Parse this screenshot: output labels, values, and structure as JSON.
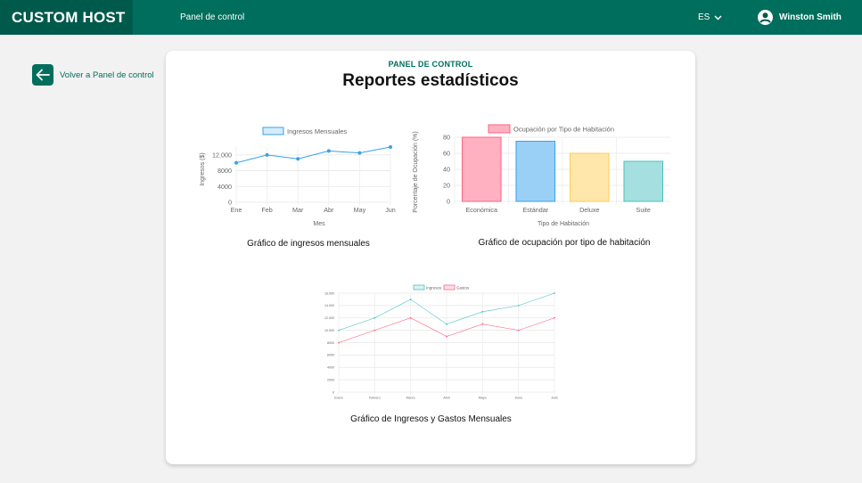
{
  "header": {
    "brand": "CUSTOM HOST",
    "nav_label": "Panel de control",
    "language": "ES",
    "user_name": "Winston Smith",
    "colors": {
      "bar": "#006e5c",
      "brand_bg": "#005a4b"
    }
  },
  "back": {
    "label": "Volver a Panel de control",
    "icon": "arrow-left-icon"
  },
  "card": {
    "kicker": "PANEL DE CONTROL",
    "title": "Reportes estadísticos"
  },
  "captions": {
    "income": "Gráfico de ingresos mensuales",
    "occupancy": "Gráfico de ocupación por tipo de habitación",
    "income_expenses": "Gráfico de Ingresos y Gastos Mensuales"
  },
  "chart_data": [
    {
      "type": "line",
      "title": "",
      "x": [
        "Ene",
        "Feb",
        "Mar",
        "Abr",
        "May",
        "Jun"
      ],
      "series": [
        {
          "name": "Ingresos Mensuales",
          "values": [
            10000,
            12000,
            11000,
            13000,
            12500,
            14000
          ],
          "color": "#36a2eb"
        }
      ],
      "xlabel": "Mes",
      "ylabel": "Ingresos ($)",
      "ylim": [
        0,
        14000
      ],
      "yticks": [
        "0",
        "4000",
        "8000",
        "12.000"
      ],
      "legend": "top",
      "grid": true
    },
    {
      "type": "bar",
      "title": "",
      "categories": [
        "Económica",
        "Estándar",
        "Deluxe",
        "Suite"
      ],
      "series": [
        {
          "name": "Ocupación por Tipo de Habitación",
          "values": [
            80,
            75,
            60,
            50
          ]
        }
      ],
      "colors": [
        "#ffb1c1",
        "#9ad0f5",
        "#ffe6aa",
        "#a5dfdf"
      ],
      "borders": [
        "#ff6384",
        "#36a2eb",
        "#ffcd56",
        "#4bc0c0"
      ],
      "xlabel": "Tipo de Habitación",
      "ylabel": "Porcentaje de Ocupación (%)",
      "ylim": [
        0,
        80
      ],
      "yticks": [
        "0",
        "20",
        "40",
        "60",
        "80"
      ],
      "legend": "top",
      "grid": true
    },
    {
      "type": "line",
      "title": "",
      "x": [
        "Enero",
        "Febrero",
        "Marzo",
        "Abril",
        "Mayo",
        "Junio",
        "Julio"
      ],
      "series": [
        {
          "name": "Ingresos",
          "values": [
            10000,
            12000,
            15000,
            11000,
            13000,
            14000,
            16000
          ],
          "color": "#4bc0c0"
        },
        {
          "name": "Gastos",
          "values": [
            8000,
            10000,
            12000,
            9000,
            11000,
            10000,
            12000
          ],
          "color": "#ff6384"
        }
      ],
      "xlabel": "",
      "ylabel": "",
      "ylim": [
        0,
        16000
      ],
      "yticks": [
        "0",
        "2000",
        "4000",
        "6000",
        "8000",
        "10.000",
        "12.000",
        "14.000",
        "16.000"
      ],
      "legend": "top",
      "grid": true
    }
  ]
}
